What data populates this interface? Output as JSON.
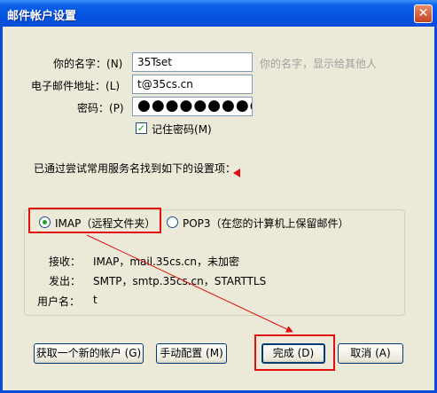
{
  "window": {
    "title": "邮件帐户设置",
    "close_symbol": "✕"
  },
  "form": {
    "name_label": "你的名字：",
    "name_key": "(N)",
    "name_value": "35Tset",
    "name_hint": "你的名字，显示给其他人",
    "email_label": "电子邮件地址：",
    "email_key": "(L)",
    "email_value": "t@35cs.cn",
    "password_label": "密码：",
    "password_key": "(P)",
    "password_value": "●●●●●●●●●",
    "remember_label": "记住密码",
    "remember_key": "(M)",
    "remember_checked": true
  },
  "found_text": "已通过尝试常用服务名找到如下的设置项：",
  "options": {
    "imap_label": "IMAP（远程文件夹）",
    "imap_selected": true,
    "pop3_label": "POP3（在您的计算机上保留邮件）",
    "pop3_selected": false
  },
  "details": [
    {
      "label": "接收：",
      "value": "IMAP，mail.35cs.cn，未加密"
    },
    {
      "label": "发出：",
      "value": "SMTP，smtp.35cs.cn，STARTTLS"
    },
    {
      "label": "用户名：",
      "value": "t"
    }
  ],
  "buttons": {
    "new_account": "获取一个新的帐户 (G)",
    "manual_config": "手动配置 (M)",
    "done": "完成 (D)",
    "cancel": "取消 (A)"
  },
  "colors": {
    "annotation_red": "#e01010",
    "titlebar_blue": "#0a4cd8",
    "dialog_bg": "#ece9d8"
  }
}
